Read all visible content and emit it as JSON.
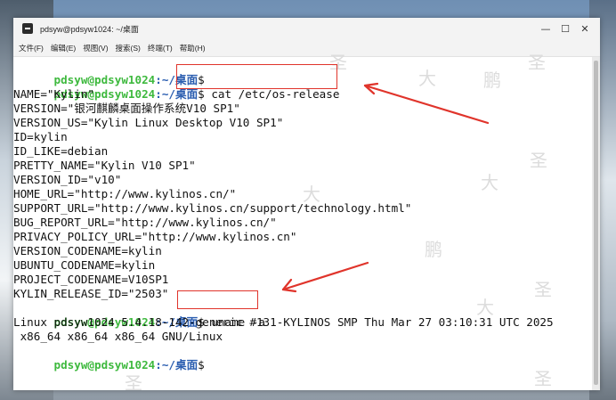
{
  "window": {
    "title": "pdsyw@pdsyw1024: ~/桌面",
    "controls": {
      "minimize": "—",
      "maximize": "☐",
      "close": "✕"
    }
  },
  "menu": [
    "文件(F)",
    "编辑(E)",
    "视图(V)",
    "搜索(S)",
    "终端(T)",
    "帮助(H)"
  ],
  "terminal": {
    "prompt_user": "pdsyw@pdsyw1024",
    "prompt_path": ":~/桌面",
    "prompt_sign": "$",
    "cmd1": " cat /etc/os-release",
    "cmd2": " uname -a",
    "output1": [
      "NAME=\"Kylin\"",
      "VERSION=\"银河麒麟桌面操作系统V10 SP1\"",
      "VERSION_US=\"Kylin Linux Desktop V10 SP1\"",
      "ID=kylin",
      "ID_LIKE=debian",
      "PRETTY_NAME=\"Kylin V10 SP1\"",
      "VERSION_ID=\"v10\"",
      "HOME_URL=\"http://www.kylinos.cn/\"",
      "SUPPORT_URL=\"http://www.kylinos.cn/support/technology.html\"",
      "BUG_REPORT_URL=\"http://www.kylinos.cn/\"",
      "PRIVACY_POLICY_URL=\"http://www.kylinos.cn\"",
      "VERSION_CODENAME=kylin",
      "UBUNTU_CODENAME=kylin",
      "PROJECT_CODENAME=V10SP1",
      "KYLIN_RELEASE_ID=\"2503\""
    ],
    "output2": [
      "Linux pdsyw1024 5.4.18-142-generic #131-KYLINOS SMP Thu Mar 27 03:10:31 UTC 2025",
      " x86_64 x86_64 x86_64 GNU/Linux"
    ]
  },
  "watermarks": [
    "圣",
    "大",
    "鹏"
  ],
  "colors": {
    "prompt_user": "#3eb93e",
    "prompt_path": "#2a5db0",
    "annotation": "#e0342b"
  }
}
